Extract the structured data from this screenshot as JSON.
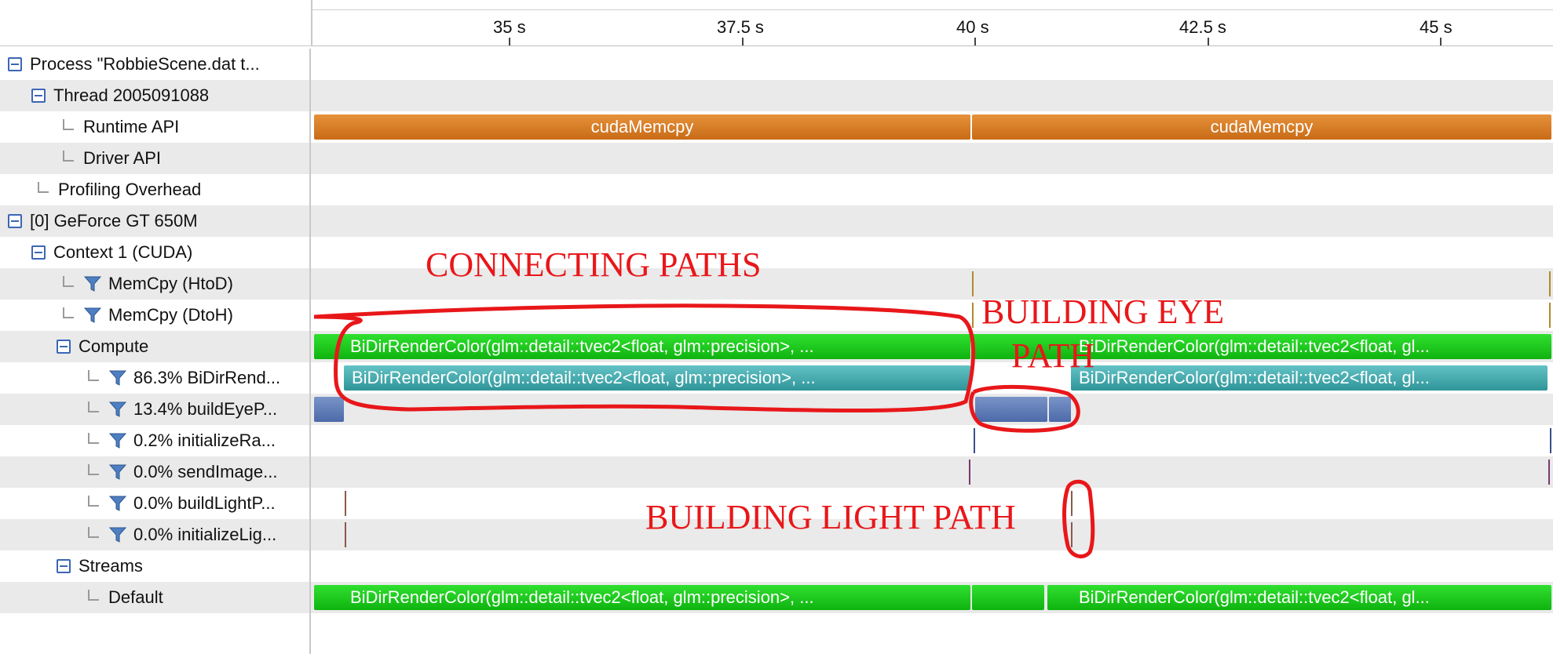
{
  "ruler": {
    "ticks": [
      "35 s",
      "37.5 s",
      "40 s",
      "42.5 s",
      "45 s"
    ]
  },
  "tree": {
    "rows": [
      {
        "label": "Process \"RobbieScene.dat t...",
        "kind": "toggle"
      },
      {
        "label": "Thread 2005091088",
        "kind": "toggle"
      },
      {
        "label": "Runtime API",
        "kind": "leaf"
      },
      {
        "label": "Driver API",
        "kind": "leaf"
      },
      {
        "label": "Profiling Overhead",
        "kind": "leaf"
      },
      {
        "label": "[0] GeForce GT 650M",
        "kind": "toggle"
      },
      {
        "label": "Context 1 (CUDA)",
        "kind": "toggle"
      },
      {
        "label": "MemCpy (HtoD)",
        "kind": "filter-leaf"
      },
      {
        "label": "MemCpy (DtoH)",
        "kind": "filter-leaf"
      },
      {
        "label": "Compute",
        "kind": "toggle"
      },
      {
        "label": "86.3% BiDirRend...",
        "kind": "filter-leaf"
      },
      {
        "label": "13.4% buildEyeP...",
        "kind": "filter-leaf"
      },
      {
        "label": "0.2% initializeRa...",
        "kind": "filter-leaf"
      },
      {
        "label": "0.0% sendImage...",
        "kind": "filter-leaf"
      },
      {
        "label": "0.0% buildLightP...",
        "kind": "filter-leaf"
      },
      {
        "label": "0.0% initializeLig...",
        "kind": "filter-leaf"
      },
      {
        "label": "Streams",
        "kind": "toggle"
      },
      {
        "label": "Default",
        "kind": "leaf"
      }
    ]
  },
  "timeline": {
    "runtime_bars": [
      "cudaMemcpy",
      "cudaMemcpy"
    ],
    "compute_bars": [
      "BiDirRenderColor(glm::detail::tvec2<float, glm::precision>, ...",
      "BiDirRenderColor(glm::detail::tvec2<float, gl..."
    ],
    "bidir_bars": [
      "BiDirRenderColor(glm::detail::tvec2<float, glm::precision>, ...",
      "BiDirRenderColor(glm::detail::tvec2<float, gl..."
    ],
    "default_bars": [
      "BiDirRenderColor(glm::detail::tvec2<float, glm::precision>, ...",
      "BiDirRenderColor(glm::detail::tvec2<float, gl..."
    ]
  },
  "annotations": {
    "connecting": "CONNECTING PATHS",
    "building_eye_1": "BUILDING EYE",
    "building_eye_2": "PATH",
    "building_light": "BUILDING LIGHT PATH"
  },
  "colors": {
    "runtime_api": "#d27a25",
    "kernel_green": "#1fcc1f",
    "kernel_teal": "#3fa6aa",
    "kernel_blue": "#5b78b5",
    "annotation_red": "#e8171a",
    "toggle_blue": "#3c66b5"
  },
  "icons": {
    "toggle": "collapse-minus-icon",
    "filter": "funnel-filter-icon",
    "tree_line": "tree-elbow-icon"
  }
}
